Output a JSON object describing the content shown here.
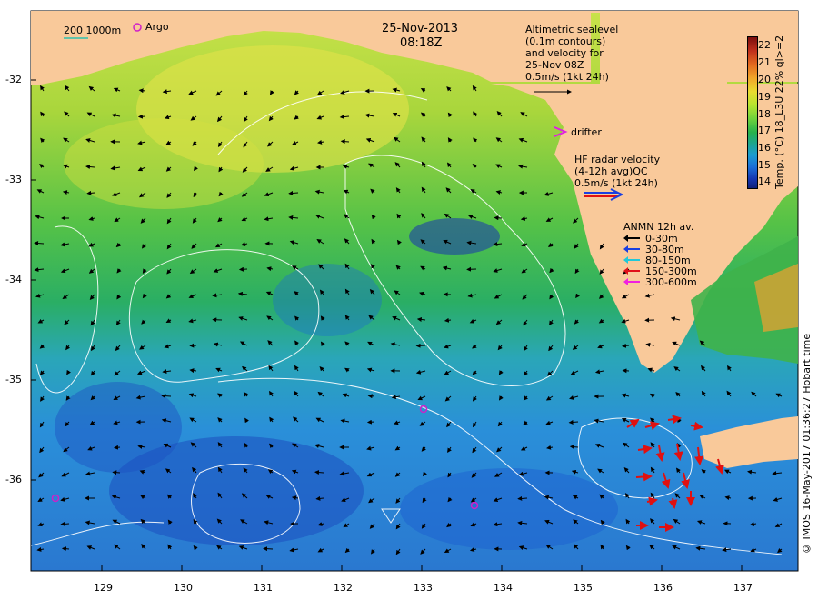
{
  "date": "25-Nov-2013",
  "time": "08:18Z",
  "scale_label": "200  1000m",
  "argo_label": "Argo",
  "altimetry_label": [
    "Altimetric sealevel",
    "(0.1m contours)",
    "and velocity for",
    "25-Nov 08Z",
    "0.5m/s (1kt 24h)"
  ],
  "drifter_label": "drifter",
  "hf_radar_label": [
    "HF radar velocity",
    "(4-12h avg)QC",
    "0.5m/s (1kt 24h)"
  ],
  "anmn_title": "ANMN 12h av.",
  "anmn_legend": [
    {
      "label": "0-30m",
      "color": "#000000"
    },
    {
      "label": "30-80m",
      "color": "#1a3fe0"
    },
    {
      "label": "80-150m",
      "color": "#20c8d8"
    },
    {
      "label": "150-300m",
      "color": "#e0101a"
    },
    {
      "label": "300-600m",
      "color": "#f020e0"
    }
  ],
  "colorbar_title": "Temp. (°C) 18_L3U 22% ql>=2",
  "colorbar_ticks": [
    "22",
    "21",
    "20",
    "19",
    "18",
    "17",
    "16",
    "15",
    "14"
  ],
  "y_ticks": [
    "-32",
    "-33",
    "-34",
    "-35",
    "-36"
  ],
  "x_ticks": [
    "129",
    "130",
    "131",
    "132",
    "133",
    "134",
    "135",
    "136",
    "137"
  ],
  "credit": "© IMOS 16-May-2017 01:36:27 Hobart time",
  "colors": {
    "land": "#f9c99a",
    "argo": "#d020c8",
    "drifter": "#e020e0",
    "hf_radar": "#e01010",
    "contour": "#ffffff"
  }
}
